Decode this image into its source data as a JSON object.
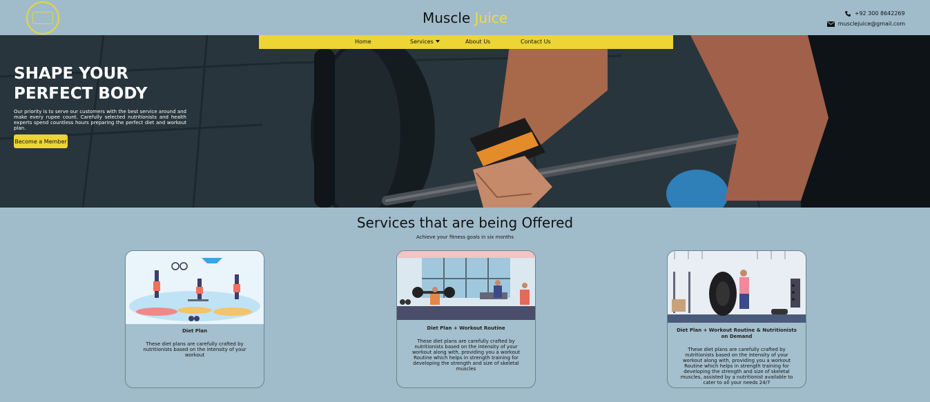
{
  "header": {
    "brand_part1": "Muscle",
    "brand_part2": "Juice",
    "phone": "+92 300 8642269",
    "email": "musclejuice@gmail.com"
  },
  "nav": {
    "home": "Home",
    "services": "Services",
    "about": "About Us",
    "contact": "Contact Us"
  },
  "hero": {
    "title_line1": "SHAPE YOUR",
    "title_line2": "PERFECT BODY",
    "text": "Our priority is to serve our customers with the best service around and make every rupee count. Carefully selected nutritionists and health experts spend countless hours preparing the perfect diet and workout plan.",
    "button": "Become a Member"
  },
  "services": {
    "title": "Services that are being Offered",
    "subtitle": "Achieve your fitness goals in six months",
    "cards": [
      {
        "title": "Diet Plan",
        "desc": "These diet plans are carefully crafted by nutritionists based on the intensity of your workout"
      },
      {
        "title": "Diet Plan + Workout Routine",
        "desc": "These diet plans are carefully crafted by nutritionists based on the intensity of your workout along with, providing you a workout Routine which helps in strength training for developing the strength and size of skeletal muscles"
      },
      {
        "title": "Diet Plan + Workout Routine & Nutritionists on Demand",
        "desc": "These diet plans are carefully crafted by nutritionists based on the intensity of your workout along with, providing you a workout Routine which helps in strength training for developing the strength and size of skeletal muscles, assisted by a nutritionist available to cater to all your needs 24/7"
      }
    ]
  },
  "colors": {
    "page_bg": "#a0bccb",
    "accent_yellow": "#ecd535",
    "hero_dark": "#26343c"
  },
  "icons": {
    "phone": "phone-icon",
    "mail": "mail-icon",
    "caret": "caret-down-icon"
  }
}
